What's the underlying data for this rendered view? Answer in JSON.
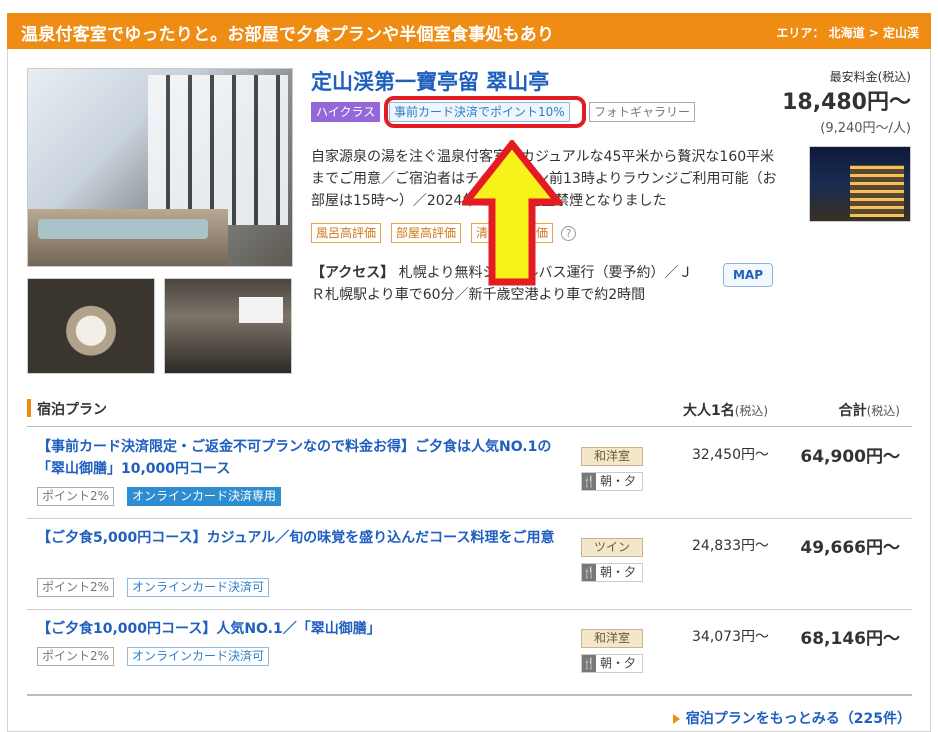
{
  "banner": {
    "title": "温泉付客室でゆったりと。お部屋で夕食プランや半個室食事処もあり",
    "area_prefix": "エリア：",
    "area_path": "北海道 > 定山渓"
  },
  "hotel": {
    "name": "定山渓第一寶亭留 翠山亭",
    "class_tag": "ハイクラス",
    "point_tag": "事前カード決済でポイント10%",
    "gallery_tag": "フォトギャラリー",
    "description": "自家源泉の湯を注ぐ温泉付客室はカジュアルな45平米から贅沢な160平米までご用意／ご宿泊者はチェックイン前13時よりラウンジご利用可能（お部屋は15時～）／2024年4月より全室禁煙となりました",
    "reviews": [
      "風呂高評価",
      "部屋高評価",
      "清潔感高評価"
    ],
    "help_icon": "?",
    "access_label": "【アクセス】",
    "access_text": "札幌より無料シャトルバス運行（要予約）／ＪＲ札幌駅より車で60分／新千歳空港より車で約2時間",
    "map_label": "MAP"
  },
  "price": {
    "label": "最安料金(税込)",
    "main": "18,480円～",
    "per_person": "(9,240円～/人)"
  },
  "plans": {
    "header": {
      "title": "宿泊プラン",
      "col_per_person": "大人1名",
      "col_total": "合計",
      "tax_note": "(税込)"
    },
    "rows": [
      {
        "name": "【事前カード決済限定・ご返金不可プランなので料金お得】ご夕食は人気NO.1の「翠山御膳」10,000円コース",
        "point": "ポイント2%",
        "payment": "オンラインカード決済専用",
        "room": "和洋室",
        "meal": "朝・夕",
        "price_per": "32,450円～",
        "total": "64,900円～"
      },
      {
        "name": "【ご夕食5,000円コース】カジュアル／旬の味覚を盛り込んだコース料理をご用意",
        "point": "ポイント2%",
        "payment": "オンラインカード決済可",
        "room": "ツイン",
        "meal": "朝・夕",
        "price_per": "24,833円～",
        "total": "49,666円～"
      },
      {
        "name": "【ご夕食10,000円コース】人気NO.1／「翠山御膳」",
        "point": "ポイント2%",
        "payment": "オンラインカード決済可",
        "room": "和洋室",
        "meal": "朝・夕",
        "price_per": "34,073円～",
        "total": "68,146円～"
      }
    ],
    "more_link": "宿泊プランをもっとみる（225件）"
  },
  "colors": {
    "banner": "#ef8c14",
    "link": "#1f5fbf",
    "class_tag": "#9468d8",
    "highlight": "#e31b22",
    "arrow_fill": "#f7f21a"
  }
}
